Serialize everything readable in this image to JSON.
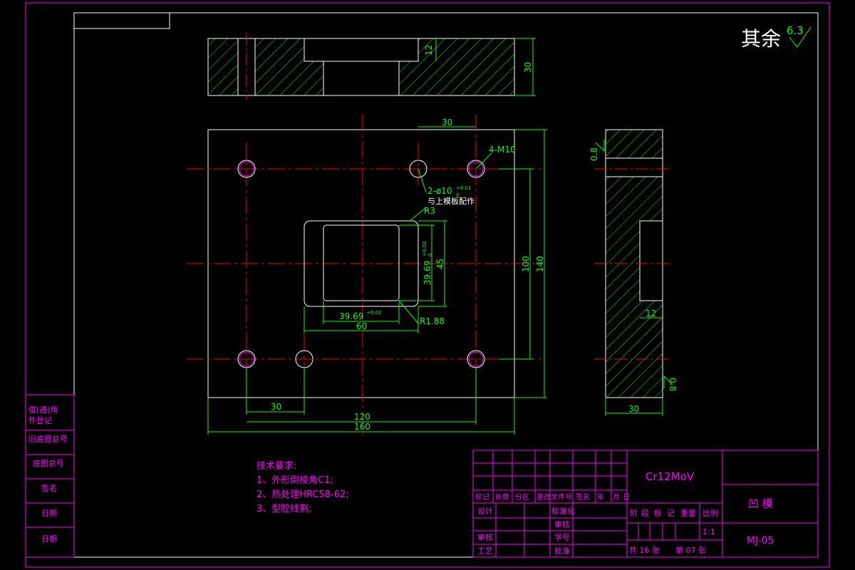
{
  "surface_note": {
    "prefix": "其余",
    "roughness": "6.3"
  },
  "top_view": {
    "depth_dim": "12",
    "height_dim": "30"
  },
  "front_view": {
    "dims": {
      "hole_spacing_top": "30",
      "thread": "4-M10",
      "pin_hole": "2-ø10",
      "pin_tol_upper": "+0.01",
      "pin_tol_lower": "0",
      "pin_note": "与上模板配作",
      "radius_outer": "R3",
      "cavity_h": "39.69",
      "cavity_h_tol_upper": "+0.02",
      "cavity_h_tol_lower": "0",
      "opening_h": "45",
      "cavity_w": "39.69",
      "cavity_w_tol": "+0.02",
      "opening_w": "60",
      "radius_inner": "R1.88",
      "height_100": "100",
      "height_140": "140",
      "width_30": "30",
      "width_120": "120",
      "width_160": "160"
    }
  },
  "side_view": {
    "rough_top": "0.8",
    "depth_dim": "12",
    "rough_bottom": "0.8",
    "width_dim": "30"
  },
  "tech": {
    "title": "技术要求:",
    "items": [
      "1、外形倒棱角C1;",
      "2、热处理HRC58-62;",
      "3、型腔线割;"
    ]
  },
  "left_strip": [
    "借(通)用",
    "件登记",
    "旧底图总号",
    "底图总号",
    "签名",
    "日期",
    "日期"
  ],
  "title_block": {
    "material": "Cr12MoV",
    "part_name": "凹    模",
    "drawing_no": "MJ-05",
    "revision_headers": [
      "标记",
      "处数",
      "分区",
      "更改文件号",
      "签名",
      "年",
      "月",
      "日"
    ],
    "roles_left": [
      "设计",
      "审核",
      "工艺"
    ],
    "roles_mid": [
      "标准化",
      "审核",
      "学号",
      "批准"
    ],
    "stage_headers": [
      "阶",
      "段",
      "标",
      "记",
      "重量",
      "比例"
    ],
    "scale": "1:1",
    "sheets_total": "共 16 张",
    "sheet_no": "第 07 张"
  }
}
